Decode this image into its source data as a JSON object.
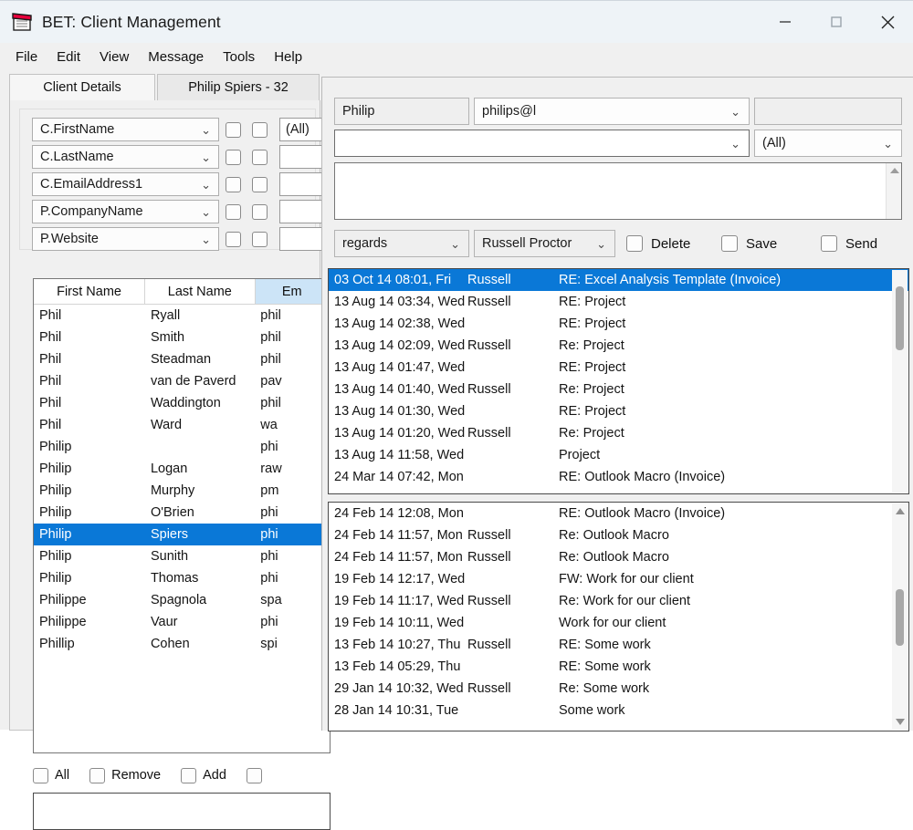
{
  "window": {
    "title": "BET: Client Management",
    "icon": "notepad-icon",
    "minimize": "—",
    "maximize": "□",
    "close": "✕"
  },
  "menu": {
    "items": [
      "File",
      "Edit",
      "View",
      "Message",
      "Tools",
      "Help"
    ]
  },
  "tabs": [
    {
      "label": "Client Details",
      "active": true
    },
    {
      "label": "Philip Spiers - 32",
      "active": false
    }
  ],
  "left_panel": {
    "filters": [
      {
        "field": "C.FirstName",
        "value": "(All)"
      },
      {
        "field": "C.LastName",
        "value": ""
      },
      {
        "field": "C.EmailAddress1",
        "value": ""
      },
      {
        "field": "P.CompanyName",
        "value": ""
      },
      {
        "field": "P.Website",
        "value": ""
      }
    ],
    "grid": {
      "columns": [
        "First Name",
        "Last Name",
        "Em"
      ],
      "selected_column": "Em",
      "rows": [
        {
          "first": "Phil",
          "last": "Ryall",
          "email": "phil",
          "selected": false
        },
        {
          "first": "Phil",
          "last": "Smith",
          "email": "phil",
          "selected": false
        },
        {
          "first": "Phil",
          "last": "Steadman",
          "email": "phil",
          "selected": false
        },
        {
          "first": "Phil",
          "last": "van de Paverd",
          "email": "pav",
          "selected": false
        },
        {
          "first": "Phil",
          "last": "Waddington",
          "email": "phil",
          "selected": false
        },
        {
          "first": "Phil",
          "last": "Ward",
          "email": "wa",
          "selected": false
        },
        {
          "first": "Philip",
          "last": "",
          "email": "phi",
          "selected": false
        },
        {
          "first": "Philip",
          "last": "Logan",
          "email": "raw",
          "selected": false
        },
        {
          "first": "Philip",
          "last": "Murphy",
          "email": "pm",
          "selected": false
        },
        {
          "first": "Philip",
          "last": "O'Brien",
          "email": "phi",
          "selected": false
        },
        {
          "first": "Philip",
          "last": "Spiers",
          "email": "phi",
          "selected": true
        },
        {
          "first": "Philip",
          "last": "Sunith",
          "email": "phi",
          "selected": false
        },
        {
          "first": "Philip",
          "last": "Thomas",
          "email": "phi",
          "selected": false
        },
        {
          "first": "Philippe",
          "last": "Spagnola",
          "email": "spa",
          "selected": false
        },
        {
          "first": "Philippe",
          "last": "Vaur",
          "email": "phi",
          "selected": false
        },
        {
          "first": "Phillip",
          "last": "Cohen",
          "email": "spi",
          "selected": false
        }
      ]
    },
    "checkboxes": [
      {
        "label": "All",
        "checked": false
      },
      {
        "label": "Remove",
        "checked": false
      },
      {
        "label": "Add",
        "checked": false
      },
      {
        "label": "",
        "checked": false
      }
    ]
  },
  "right_panel": {
    "name_field": "Philip",
    "email_field": "philips@l",
    "extra_field": "",
    "subject_field": "",
    "all_field": "(All)",
    "body_field": "",
    "signature_field": "regards",
    "sender_field": "Russell Proctor",
    "actions": [
      {
        "label": "Delete",
        "checked": false
      },
      {
        "label": "Save",
        "checked": false
      },
      {
        "label": "Send",
        "checked": false
      }
    ],
    "messages_top": [
      {
        "date": "03 Oct 14 08:01, Fri",
        "sender": "Russell",
        "subject": "RE: Excel Analysis Template (Invoice)",
        "selected": true
      },
      {
        "date": "13 Aug 14 03:34, Wed",
        "sender": "Russell",
        "subject": "RE: Project",
        "selected": false
      },
      {
        "date": "13 Aug 14 02:38, Wed",
        "sender": "",
        "subject": "RE: Project",
        "selected": false
      },
      {
        "date": "13 Aug 14 02:09, Wed",
        "sender": "Russell",
        "subject": "Re: Project",
        "selected": false
      },
      {
        "date": "13 Aug 14 01:47, Wed",
        "sender": "",
        "subject": "RE: Project",
        "selected": false
      },
      {
        "date": "13 Aug 14 01:40, Wed",
        "sender": "Russell",
        "subject": "Re: Project",
        "selected": false
      },
      {
        "date": "13 Aug 14 01:30, Wed",
        "sender": "",
        "subject": "RE: Project",
        "selected": false
      },
      {
        "date": "13 Aug 14 01:20, Wed",
        "sender": "Russell",
        "subject": "Re: Project",
        "selected": false
      },
      {
        "date": "13 Aug 14 11:58, Wed",
        "sender": "",
        "subject": "Project",
        "selected": false
      },
      {
        "date": "24 Mar 14 07:42, Mon",
        "sender": "",
        "subject": "RE: Outlook Macro (Invoice)",
        "selected": false
      }
    ],
    "messages_bottom": [
      {
        "date": "24 Feb 14 12:08, Mon",
        "sender": "",
        "subject": "RE: Outlook Macro (Invoice)",
        "selected": false
      },
      {
        "date": "24 Feb 14 11:57, Mon",
        "sender": "Russell",
        "subject": "Re: Outlook Macro",
        "selected": false
      },
      {
        "date": "24 Feb 14 11:57, Mon",
        "sender": "Russell",
        "subject": "Re: Outlook Macro",
        "selected": false
      },
      {
        "date": "19 Feb 14 12:17, Wed",
        "sender": "",
        "subject": "FW: Work for our client",
        "selected": false
      },
      {
        "date": "19 Feb 14 11:17, Wed",
        "sender": "Russell",
        "subject": "Re: Work for our client",
        "selected": false
      },
      {
        "date": "19 Feb 14 10:11, Wed",
        "sender": "",
        "subject": "Work for our client",
        "selected": false
      },
      {
        "date": "13 Feb 14 10:27, Thu",
        "sender": "Russell",
        "subject": "RE: Some work",
        "selected": false
      },
      {
        "date": "13 Feb 14 05:29, Thu",
        "sender": "",
        "subject": "RE: Some work",
        "selected": false
      },
      {
        "date": "29 Jan 14 10:32, Wed",
        "sender": "Russell",
        "subject": "Re: Some work",
        "selected": false
      },
      {
        "date": "28 Jan 14 10:31, Tue",
        "sender": "",
        "subject": "Some work",
        "selected": false
      }
    ]
  },
  "colors": {
    "selection": "#0a78d7",
    "title_bar": "#eef3f7",
    "window_bg": "#f0f0f0",
    "header_selected": "#cce4f7"
  }
}
